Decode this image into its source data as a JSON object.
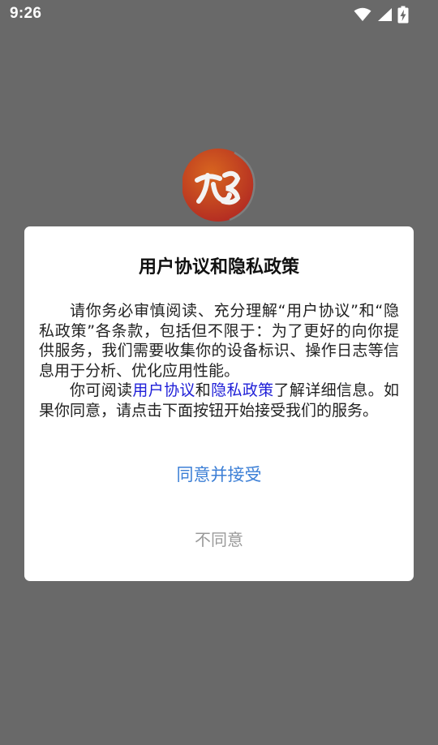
{
  "status_bar": {
    "time": "9:26",
    "icons": [
      "wifi-icon",
      "cellular-signal-icon",
      "battery-charging-icon"
    ]
  },
  "app": {
    "logo_icon": "app-logo-icon",
    "logo_colors": {
      "primary": "#d05a1e",
      "secondary": "#b82b20"
    }
  },
  "dialog": {
    "title": "用户协议和隐私政策",
    "paragraph1": "请你务必审慎阅读、充分理解“用户协议”和“隐私政策”各条款，包括但不限于：为了更好的向你提供服务，我们需要收集你的设备标识、操作日志等信息用于分析、优化应用性能。",
    "paragraph2": {
      "prefix": "你可阅读",
      "user_agreement_link": "用户协议",
      "joiner": "和",
      "privacy_policy_link": "隐私政策",
      "suffix": "了解详细信息。如果你同意，请点击下面按钮开始接受我们的服务。"
    },
    "agree_label": "同意并接受",
    "disagree_label": "不同意"
  },
  "colors": {
    "overlay": "#696969",
    "link": "#2020d8",
    "agree": "#3c7fd6",
    "disagree": "#9a9a9a"
  }
}
